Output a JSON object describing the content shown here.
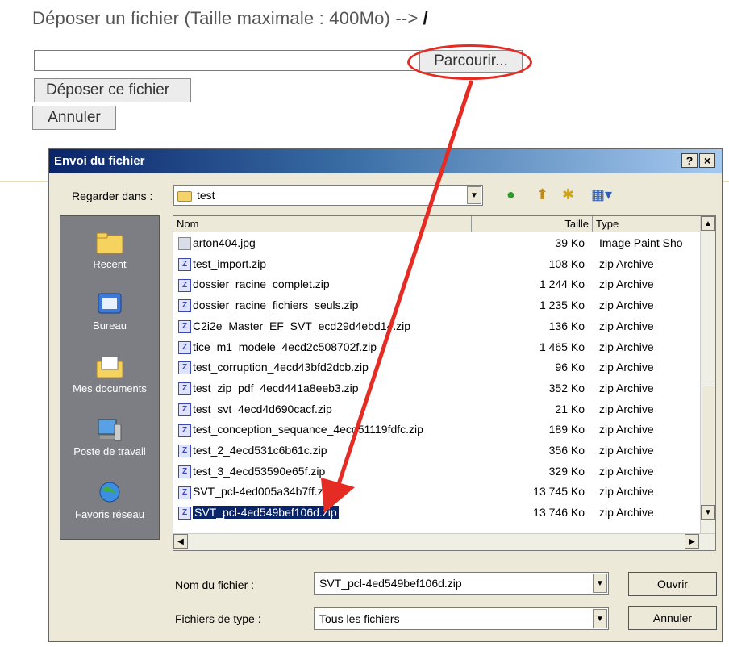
{
  "page": {
    "title": "Déposer un fichier (Taille maximale : 400Mo) -->",
    "path": "/",
    "file_input_value": "",
    "browse_label": "Parcourir...",
    "upload_label": "Déposer ce fichier",
    "cancel_label": "Annuler"
  },
  "dialog": {
    "title": "Envoi du fichier",
    "help": "?",
    "close": "×",
    "look_in_label": "Regarder dans :",
    "look_in_value": "test",
    "places": [
      {
        "label": "Recent",
        "icon": "recent-folder-icon"
      },
      {
        "label": "Bureau",
        "icon": "desktop-icon"
      },
      {
        "label": "Mes documents",
        "icon": "my-documents-icon"
      },
      {
        "label": "Poste de travail",
        "icon": "my-computer-icon"
      },
      {
        "label": "Favoris réseau",
        "icon": "network-icon"
      }
    ],
    "columns": {
      "name": "Nom",
      "size": "Taille",
      "type": "Type"
    },
    "files": [
      {
        "name": "arton404.jpg",
        "size": "39 Ko",
        "type": "Image Paint Sho",
        "icon": "image"
      },
      {
        "name": "test_import.zip",
        "size": "108 Ko",
        "type": "zip Archive",
        "icon": "zip"
      },
      {
        "name": "dossier_racine_complet.zip",
        "size": "1 244 Ko",
        "type": "zip Archive",
        "icon": "zip"
      },
      {
        "name": "dossier_racine_fichiers_seuls.zip",
        "size": "1 235 Ko",
        "type": "zip Archive",
        "icon": "zip"
      },
      {
        "name": "C2i2e_Master_EF_SVT_ecd29d4ebd14.zip",
        "size": "136 Ko",
        "type": "zip Archive",
        "icon": "zip"
      },
      {
        "name": "tice_m1_modele_4ecd2c508702f.zip",
        "size": "1 465 Ko",
        "type": "zip Archive",
        "icon": "zip"
      },
      {
        "name": "test_corruption_4ecd43bfd2dcb.zip",
        "size": "96 Ko",
        "type": "zip Archive",
        "icon": "zip"
      },
      {
        "name": "test_zip_pdf_4ecd441a8eeb3.zip",
        "size": "352 Ko",
        "type": "zip Archive",
        "icon": "zip"
      },
      {
        "name": "test_svt_4ecd4d690cacf.zip",
        "size": "21 Ko",
        "type": "zip Archive",
        "icon": "zip"
      },
      {
        "name": "test_conception_sequance_4ecd51119fdfc.zip",
        "size": "189 Ko",
        "type": "zip Archive",
        "icon": "zip"
      },
      {
        "name": "test_2_4ecd531c6b61c.zip",
        "size": "356 Ko",
        "type": "zip Archive",
        "icon": "zip"
      },
      {
        "name": "test_3_4ecd53590e65f.zip",
        "size": "329 Ko",
        "type": "zip Archive",
        "icon": "zip"
      },
      {
        "name": "SVT_pcl-4ed005a34b7ff.zip",
        "size": "13 745 Ko",
        "type": "zip Archive",
        "icon": "zip"
      },
      {
        "name": "SVT_pcl-4ed549bef106d.zip",
        "size": "13 746 Ko",
        "type": "zip Archive",
        "icon": "zip",
        "selected": true
      }
    ],
    "filename_label": "Nom du fichier :",
    "filename_value": "SVT_pcl-4ed549bef106d.zip",
    "filetype_label": "Fichiers de type :",
    "filetype_value": "Tous les fichiers",
    "open_label": "Ouvrir",
    "cancel_label": "Annuler"
  },
  "colors": {
    "annotation_red": "#e42c25",
    "selection": "#0a246a",
    "titlebar": "#0a246a",
    "places_bar": "#7d7d84"
  }
}
